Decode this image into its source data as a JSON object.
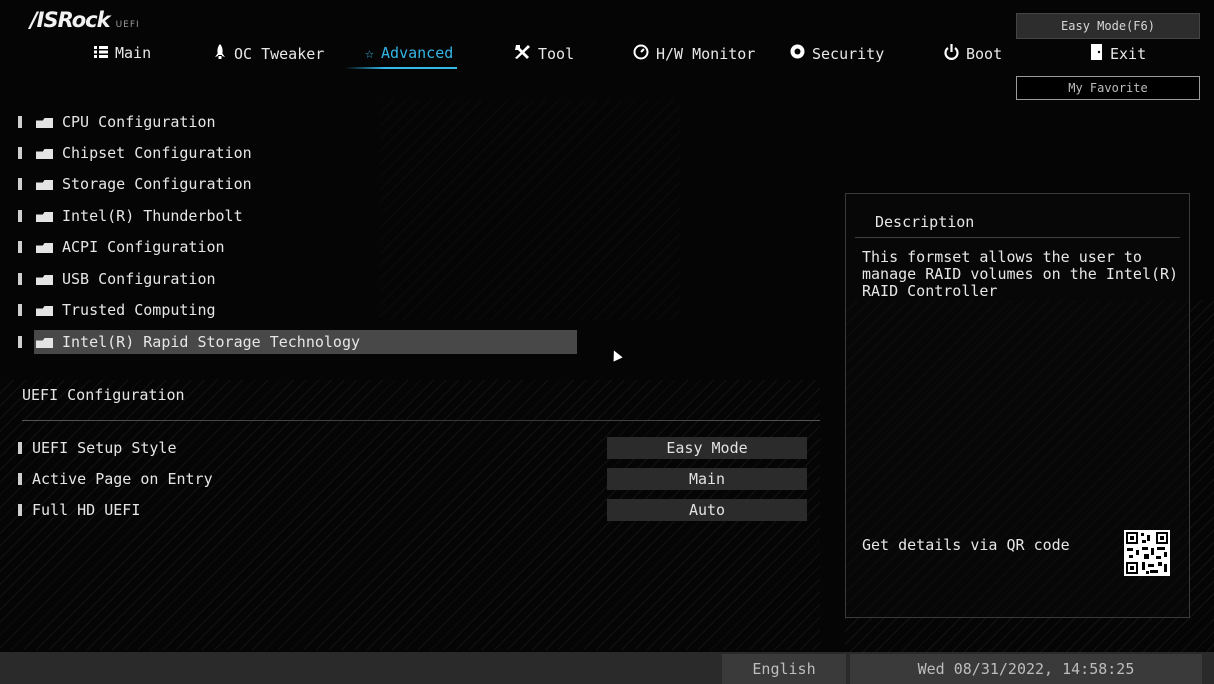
{
  "brand": {
    "name": "/ISRock",
    "sub": "UEFI"
  },
  "top_buttons": {
    "easy_mode": "Easy Mode(F6)",
    "my_favorite": "My Favorite"
  },
  "tabs": [
    {
      "label": "Main",
      "icon": "list-icon"
    },
    {
      "label": "OC Tweaker",
      "icon": "rocket-icon"
    },
    {
      "label": "Advanced",
      "icon": "star-icon",
      "active": true
    },
    {
      "label": "Tool",
      "icon": "wrench-screwdriver-icon"
    },
    {
      "label": "H/W Monitor",
      "icon": "gauge-icon"
    },
    {
      "label": "Security",
      "icon": "shield-icon"
    },
    {
      "label": "Boot",
      "icon": "power-icon"
    },
    {
      "label": "Exit",
      "icon": "exit-door-icon"
    }
  ],
  "menu_items": [
    {
      "label": "CPU Configuration"
    },
    {
      "label": "Chipset Configuration"
    },
    {
      "label": "Storage Configuration"
    },
    {
      "label": "Intel(R) Thunderbolt"
    },
    {
      "label": "ACPI Configuration"
    },
    {
      "label": "USB Configuration"
    },
    {
      "label": "Trusted Computing"
    },
    {
      "label": "Intel(R) Rapid Storage Technology",
      "selected": true
    }
  ],
  "uefi_section": {
    "title": "UEFI Configuration",
    "settings": [
      {
        "label": "UEFI Setup Style",
        "value": "Easy Mode"
      },
      {
        "label": "Active Page on Entry",
        "value": "Main"
      },
      {
        "label": "Full HD UEFI",
        "value": "Auto"
      }
    ]
  },
  "description": {
    "title": "Description",
    "text": "This formset allows the user to\nmanage RAID volumes on the Intel(R)\nRAID Controller",
    "qr_text": "Get details via QR code"
  },
  "status_bar": {
    "language": "English",
    "datetime": "Wed 08/31/2022, 14:58:25"
  },
  "colors": {
    "accent": "#34b6e6",
    "selected_bg": "#484848",
    "background": "#050505"
  }
}
